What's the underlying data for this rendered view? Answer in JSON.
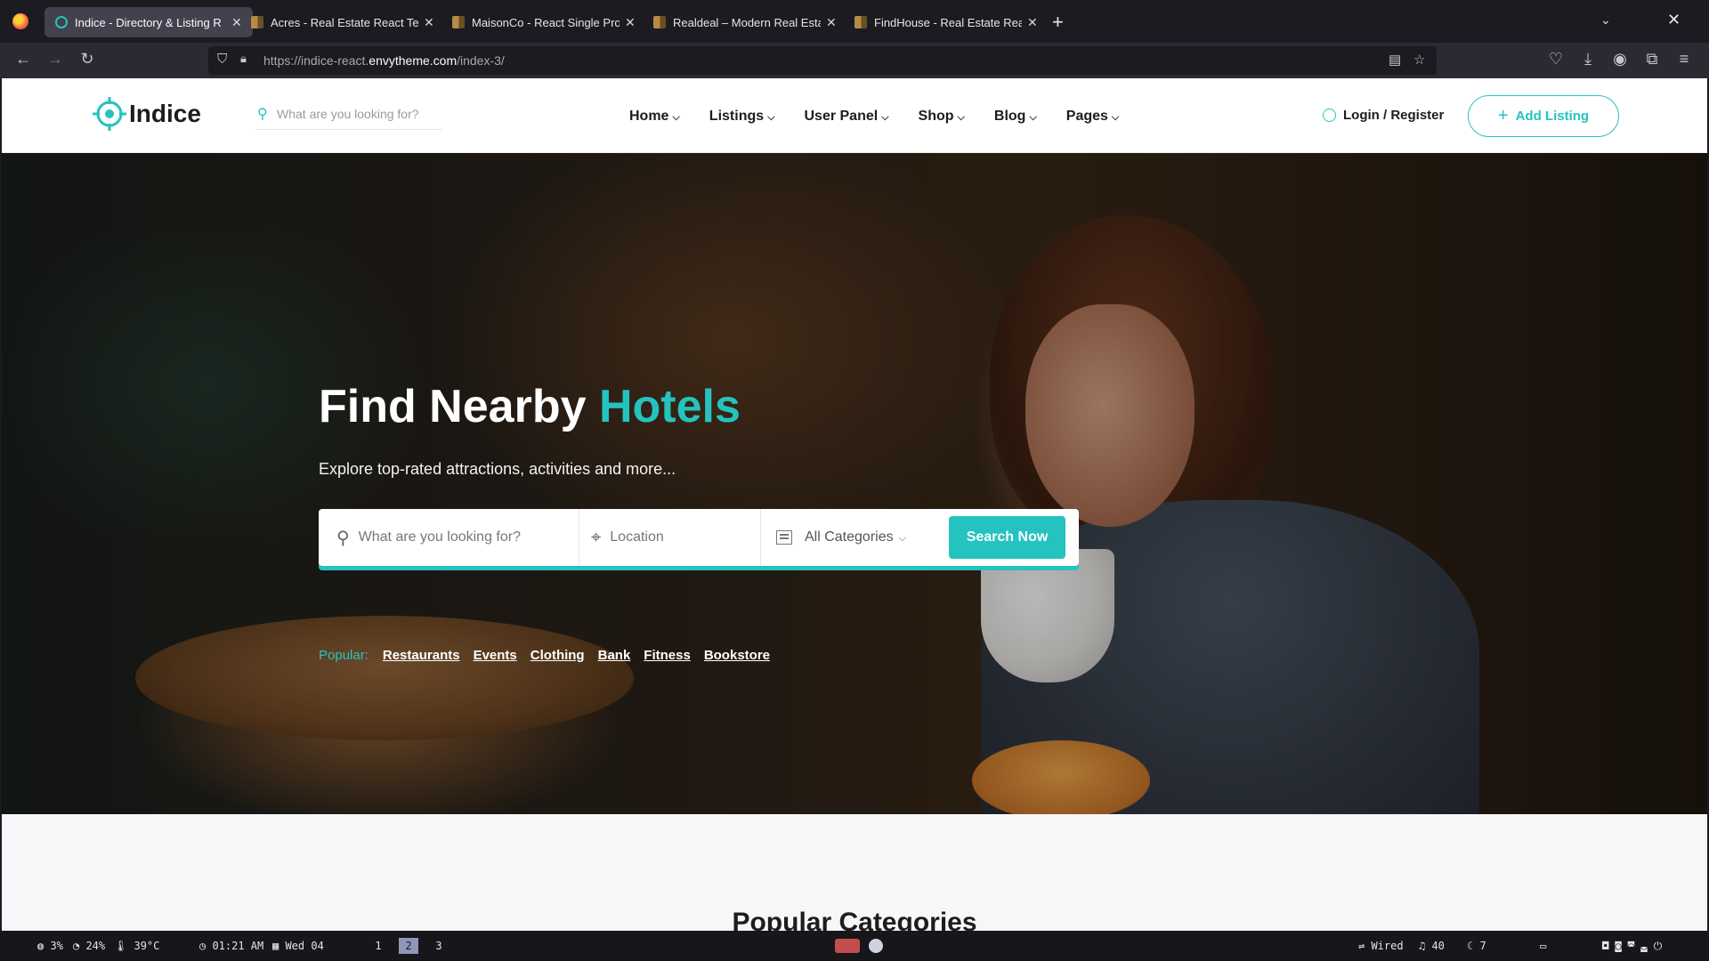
{
  "browser": {
    "tabs": [
      {
        "title": "Indice - Directory & Listing R",
        "icon": "indice-favicon",
        "active": true
      },
      {
        "title": "Acres - Real Estate React Te",
        "icon": "document-favicon",
        "active": false
      },
      {
        "title": "MaisonCo - React Single Pro",
        "icon": "document-favicon",
        "active": false
      },
      {
        "title": "Realdeal – Modern Real Esta",
        "icon": "document-favicon",
        "active": false
      },
      {
        "title": "FindHouse - Real Estate Rea",
        "icon": "document-favicon",
        "active": false
      }
    ],
    "new_tab": "+",
    "url_prefix": "https://indice-react.",
    "url_domain": "envytheme.com",
    "url_path": "/index-3/"
  },
  "site": {
    "brand": "Indice",
    "header_search_placeholder": "What are you looking for?",
    "nav": [
      "Home",
      "Listings",
      "User Panel",
      "Shop",
      "Blog",
      "Pages"
    ],
    "login": "Login / Register",
    "add_listing": "Add Listing",
    "accent": "#25c3c0"
  },
  "hero": {
    "title_lead": "Find Nearby",
    "title_accent": "Hotels",
    "subtitle": "Explore top-rated attractions, activities and more...",
    "search_placeholder": "What are you looking for?",
    "location_placeholder": "Location",
    "category": "All Categories",
    "search_button": "Search Now",
    "popular_label": "Popular:",
    "popular": [
      "Restaurants",
      "Events",
      "Clothing",
      "Bank",
      "Fitness",
      "Bookstore"
    ]
  },
  "section": {
    "title": "Popular Categories"
  },
  "system": {
    "cpu": "3%",
    "mem": "24%",
    "temp": "39°C",
    "time": "01:21 AM",
    "date": "Wed 04",
    "workspaces": [
      "1",
      "2",
      "3"
    ],
    "active_workspace": "2",
    "network": "Wired",
    "volume": "40",
    "brightness": "7"
  }
}
